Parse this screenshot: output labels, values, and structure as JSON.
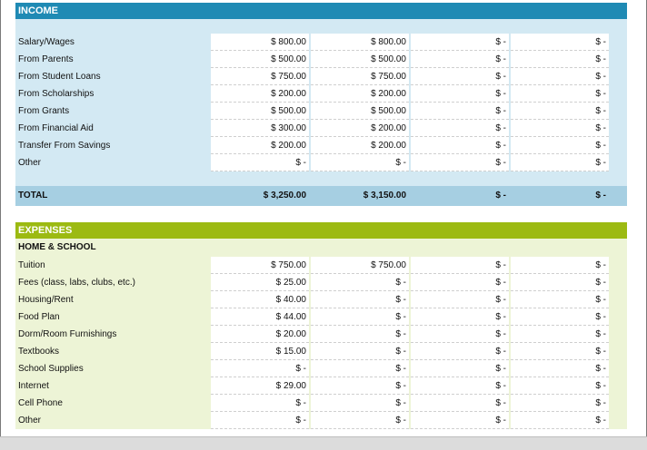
{
  "income": {
    "title": "INCOME",
    "rows": [
      {
        "label": "Salary/Wages",
        "values": [
          "$ 800.00",
          "$ 800.00",
          "$ -",
          "$ -"
        ]
      },
      {
        "label": "From Parents",
        "values": [
          "$ 500.00",
          "$ 500.00",
          "$ -",
          "$ -"
        ]
      },
      {
        "label": "From Student Loans",
        "values": [
          "$ 750.00",
          "$ 750.00",
          "$ -",
          "$ -"
        ]
      },
      {
        "label": "From Scholarships",
        "values": [
          "$ 200.00",
          "$ 200.00",
          "$ -",
          "$ -"
        ]
      },
      {
        "label": "From Grants",
        "values": [
          "$ 500.00",
          "$ 500.00",
          "$ -",
          "$ -"
        ]
      },
      {
        "label": "From Financial Aid",
        "values": [
          "$ 300.00",
          "$ 200.00",
          "$ -",
          "$ -"
        ]
      },
      {
        "label": "Transfer From Savings",
        "values": [
          "$ 200.00",
          "$ 200.00",
          "$ -",
          "$ -"
        ]
      },
      {
        "label": "Other",
        "values": [
          "$ -",
          "$ -",
          "$ -",
          "$ -"
        ]
      }
    ],
    "total": {
      "label": "TOTAL",
      "values": [
        "$ 3,250.00",
        "$ 3,150.00",
        "$ -",
        "$ -"
      ]
    }
  },
  "expenses": {
    "title": "EXPENSES",
    "subheading": "HOME & SCHOOL",
    "rows": [
      {
        "label": "Tuition",
        "values": [
          "$ 750.00",
          "$ 750.00",
          "$ -",
          "$ -"
        ]
      },
      {
        "label": "Fees (class, labs, clubs, etc.)",
        "values": [
          "$ 25.00",
          "$ -",
          "$ -",
          "$ -"
        ]
      },
      {
        "label": "Housing/Rent",
        "values": [
          "$ 40.00",
          "$ -",
          "$ -",
          "$ -"
        ]
      },
      {
        "label": "Food Plan",
        "values": [
          "$ 44.00",
          "$ -",
          "$ -",
          "$ -"
        ]
      },
      {
        "label": "Dorm/Room Furnishings",
        "values": [
          "$ 20.00",
          "$ -",
          "$ -",
          "$ -"
        ]
      },
      {
        "label": "Textbooks",
        "values": [
          "$ 15.00",
          "$ -",
          "$ -",
          "$ -"
        ]
      },
      {
        "label": "School Supplies",
        "values": [
          "$ -",
          "$ -",
          "$ -",
          "$ -"
        ]
      },
      {
        "label": "Internet",
        "values": [
          "$ 29.00",
          "$ -",
          "$ -",
          "$ -"
        ]
      },
      {
        "label": "Cell Phone",
        "values": [
          "$ -",
          "$ -",
          "$ -",
          "$ -"
        ]
      },
      {
        "label": "Other",
        "values": [
          "$ -",
          "$ -",
          "$ -",
          "$ -"
        ]
      }
    ]
  },
  "colors": {
    "income_header": "#1f8ab4",
    "income_body": "#d3e9f3",
    "income_total": "#a6cfe2",
    "expense_header": "#9cba12",
    "expense_body": "#edf4d6"
  }
}
